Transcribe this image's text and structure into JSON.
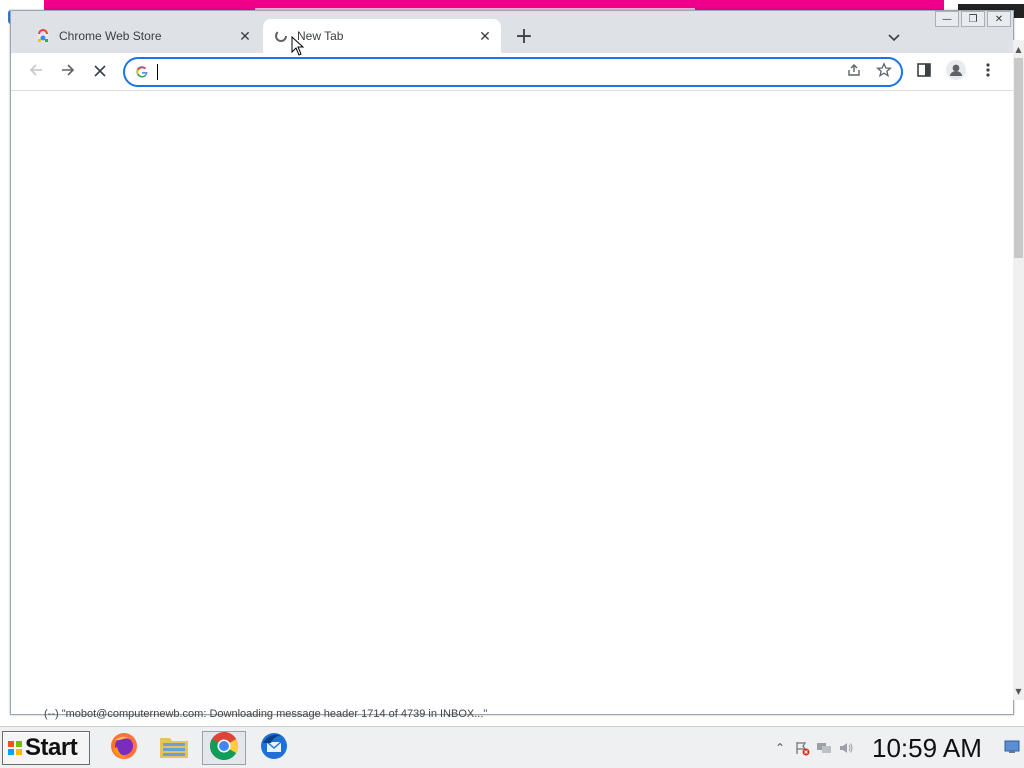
{
  "browser": {
    "tabs": [
      {
        "title": "Chrome Web Store",
        "favicon": "chrome-web-store-icon",
        "active": false
      },
      {
        "title": "New Tab",
        "favicon": "loading-spinner-icon",
        "active": true
      }
    ],
    "new_tab_symbol": "+",
    "close_symbol": "✕",
    "omnibox": {
      "value": "",
      "placeholder": ""
    },
    "accent": "#1a73e8"
  },
  "window_controls": {
    "minimize": "—",
    "restore": "❐",
    "close": "✕"
  },
  "status_message": "(--)   \"mobot@computernewb.com: Downloading message header 1714 of 4739 in INBOX...\"",
  "taskbar": {
    "start_label": "Start",
    "apps": [
      "firefox-icon",
      "file-manager-icon",
      "chrome-icon",
      "thunderbird-icon"
    ],
    "clock": "10:59 AM"
  }
}
